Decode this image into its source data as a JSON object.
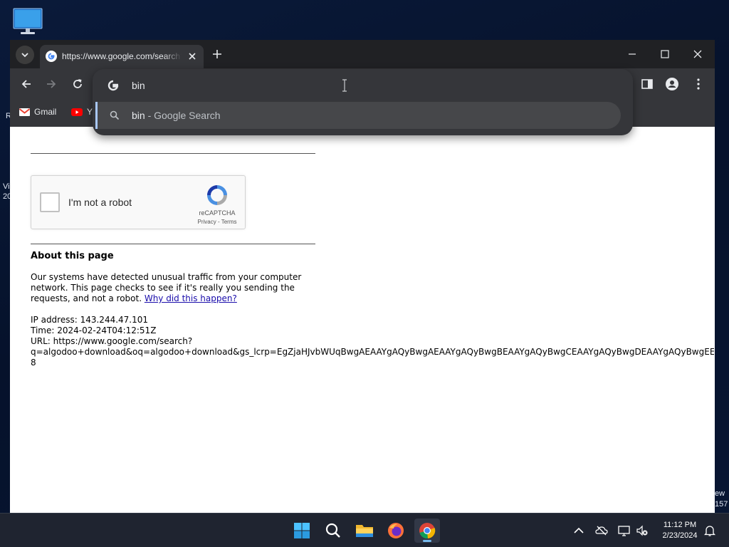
{
  "desktop": {
    "fragments": [
      "R",
      "Vi",
      "20",
      "ew",
      "157"
    ]
  },
  "browser": {
    "tab": {
      "title": "https://www.google.com/search?q=algodoo+download"
    },
    "omnibox": {
      "value": "bin",
      "suggestion_query": "bin",
      "suggestion_suffix": "- Google Search"
    },
    "bookmarks": [
      {
        "label": "Gmail"
      },
      {
        "label": "Y"
      }
    ]
  },
  "page": {
    "captcha": {
      "label": "I'm not a robot",
      "brand": "reCAPTCHA",
      "privacy": "Privacy",
      "separator": " - ",
      "terms": "Terms"
    },
    "about_heading": "About this page",
    "para_line1": "Our systems have detected unusual traffic from your computer",
    "para_line2": "network. This page checks to see if it's really you sending the",
    "para_line3": "requests, and not a robot. ",
    "why_link": "Why did this happen?",
    "ip_line": "IP address: 143.244.47.101",
    "time_line": "Time: 2024-02-24T04:12:51Z",
    "url_line1": "URL: https://www.google.com/search?",
    "url_line2": "q=algodoo+download&oq=algodoo+download&gs_lcrp=EgZjaHJvbWUqBwgAEAAYgAQyBwgAEAAYgAQyBwgBEAAYgAQyBwgCEAAYgAQyBwgDEAAYgAQyBwgEE",
    "url_line3": "8"
  },
  "taskbar": {
    "apps": [
      "start-icon",
      "search-icon",
      "file-explorer-icon",
      "firefox-icon",
      "chrome-icon"
    ],
    "clock": {
      "time": "11:12 PM",
      "date": "2/23/2024"
    }
  },
  "colors": {
    "link": "#1a0dab",
    "tab_strip": "#202124",
    "toolbar": "#35363a",
    "suggestion_highlight": "#a8c7fa"
  }
}
